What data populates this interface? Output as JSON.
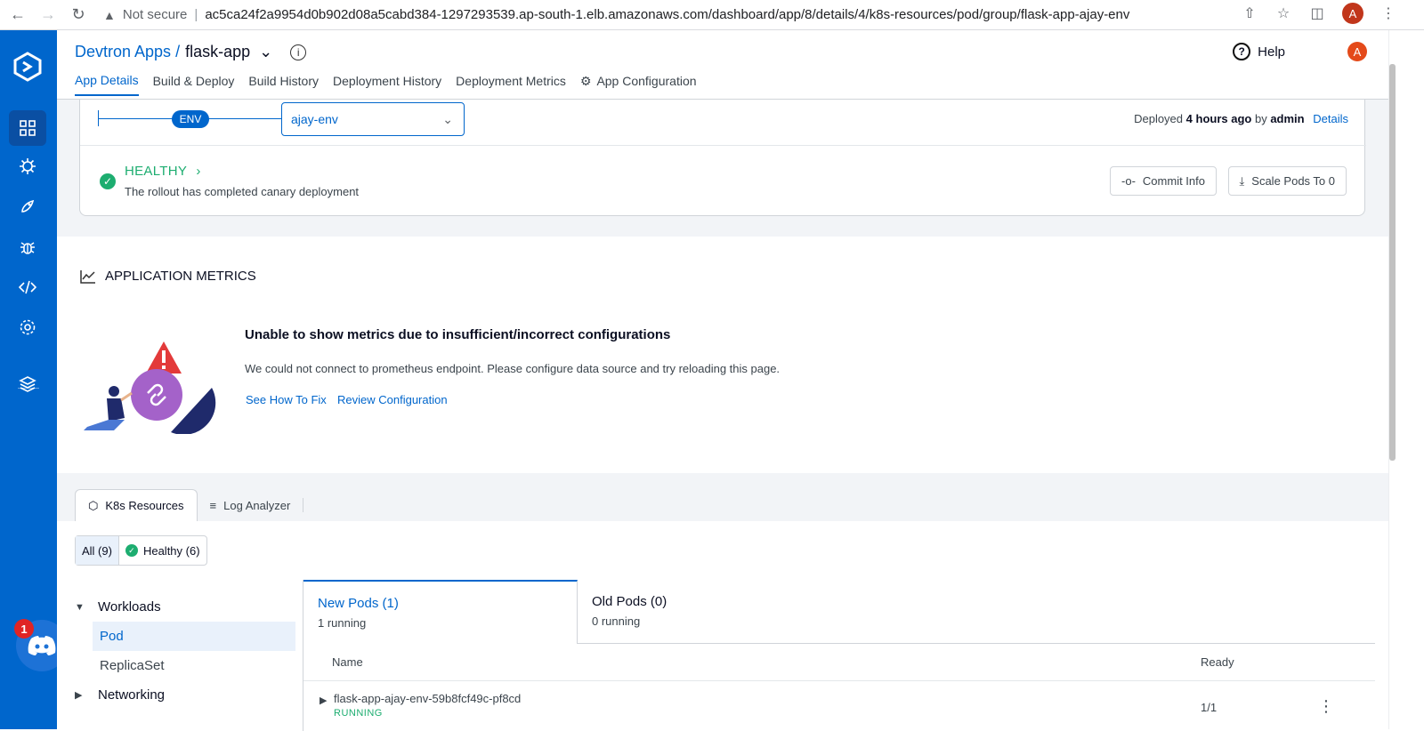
{
  "browser": {
    "security": "Not secure",
    "url": "ac5ca24f2a9954d0b902d08a5cabd384-1297293539.ap-south-1.elb.amazonaws.com/dashboard/app/8/details/4/k8s-resources/pod/group/flask-app-ajay-env",
    "avatar": "A"
  },
  "header": {
    "breadcrumb_parent": "Devtron Apps /",
    "app_name": "flask-app",
    "help_label": "Help",
    "avatar": "A",
    "tabs": [
      {
        "label": "App Details",
        "active": true
      },
      {
        "label": "Build & Deploy"
      },
      {
        "label": "Build History"
      },
      {
        "label": "Deployment History"
      },
      {
        "label": "Deployment Metrics"
      },
      {
        "label": "App Configuration"
      }
    ]
  },
  "env": {
    "pill": "ENV",
    "selected": "ajay-env",
    "deployed_prefix": "Deployed",
    "deployed_time": "4 hours ago",
    "deployed_by_prefix": "by",
    "deployed_by": "admin",
    "details_link": "Details"
  },
  "status": {
    "label": "HEALTHY",
    "description": "The rollout has completed canary deployment",
    "commit_info_btn": "Commit Info",
    "scale_btn": "Scale Pods To 0"
  },
  "metrics": {
    "title": "APPLICATION METRICS",
    "heading": "Unable to show metrics due to insufficient/incorrect configurations",
    "description": "We could not connect to prometheus endpoint. Please configure data source and try reloading this page.",
    "link_fix": "See How To Fix",
    "link_review": "Review Configuration"
  },
  "k8s": {
    "tabs": [
      "K8s Resources",
      "Log Analyzer"
    ],
    "filter_all": "All (9)",
    "filter_healthy": "Healthy (6)",
    "tree": {
      "workloads": "Workloads",
      "pod": "Pod",
      "replicaset": "ReplicaSet",
      "networking": "Networking"
    },
    "pods": {
      "new_title": "New Pods (1)",
      "new_sub": "1 running",
      "old_title": "Old Pods (0)",
      "old_sub": "0 running",
      "col_name": "Name",
      "col_ready": "Ready",
      "row_name": "flask-app-ajay-env-59b8fcf49c-pf8cd",
      "row_status": "RUNNING",
      "row_ready": "1/1"
    }
  },
  "discord_badge": "1",
  "colors": {
    "brand": "#0066cc",
    "healthy": "#1dad70"
  }
}
